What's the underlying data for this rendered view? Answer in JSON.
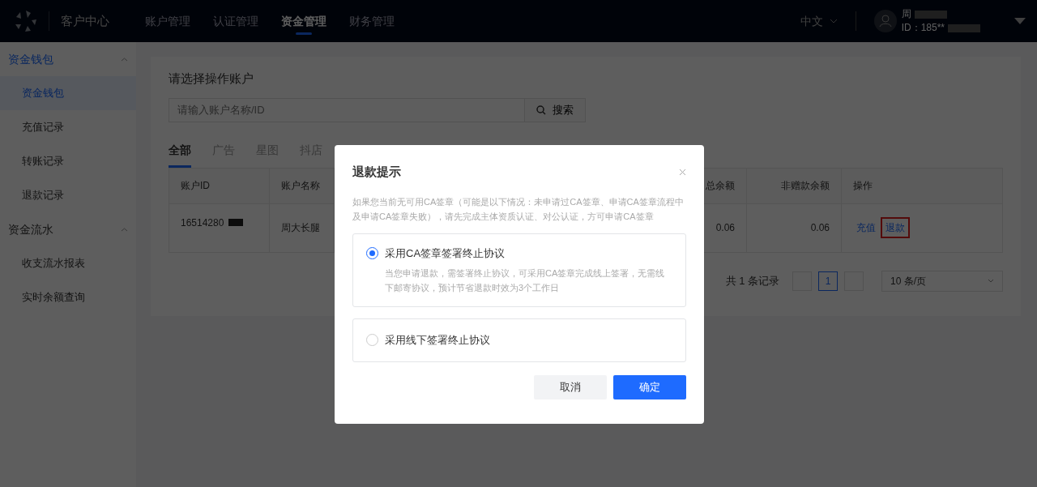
{
  "header": {
    "brand": "客户中心",
    "nav": [
      {
        "label": "账户管理",
        "selected": false
      },
      {
        "label": "认证管理",
        "selected": false
      },
      {
        "label": "资金管理",
        "selected": true
      },
      {
        "label": "财务管理",
        "selected": false
      }
    ],
    "language": "中文",
    "user": {
      "name": "周",
      "id": "ID：185**"
    }
  },
  "sidebar": {
    "groups": [
      {
        "label": "资金钱包",
        "expanded": true,
        "active": true,
        "items": [
          {
            "label": "资金钱包",
            "selected": true
          },
          {
            "label": "充值记录",
            "selected": false
          },
          {
            "label": "转账记录",
            "selected": false
          },
          {
            "label": "退款记录",
            "selected": false
          }
        ]
      },
      {
        "label": "资金流水",
        "expanded": true,
        "active": false,
        "items": [
          {
            "label": "收支流水报表",
            "selected": false
          },
          {
            "label": "实时余额查询",
            "selected": false
          }
        ]
      }
    ]
  },
  "content": {
    "title": "请选择操作账户",
    "search": {
      "placeholder": "请输入账户名称/ID",
      "button": "搜索"
    },
    "tabs": [
      {
        "label": "全部",
        "selected": true
      },
      {
        "label": "广告",
        "selected": false
      },
      {
        "label": "星图",
        "selected": false
      },
      {
        "label": "抖店",
        "selected": false
      }
    ],
    "table": {
      "columns": [
        "账户ID",
        "账户名称",
        "总余额",
        "非赠款余额",
        "操作"
      ],
      "rows": [
        {
          "id": "16514280",
          "name": "周大长腿",
          "total": "0.06",
          "non_gift": "0.06",
          "actions": [
            {
              "label": "充值",
              "highlighted": false
            },
            {
              "label": "退款",
              "highlighted": true
            }
          ]
        }
      ]
    },
    "pagination": {
      "total": "共 1 条记录",
      "pages": [
        {
          "label": "1",
          "selected": true
        }
      ],
      "page_size": "10 条/页"
    }
  },
  "dialog": {
    "title": "退款提示",
    "notice": "如果您当前无可用CA签章（可能是以下情况：未申请过CA签章、申请CA签章流程中及申请CA签章失败），请先完成主体资质认证、对公认证，方可申请CA签章",
    "options": [
      {
        "label": "采用CA签章签署终止协议",
        "description": "当您申请退款，需签署终止协议，可采用CA签章完成线上签署，无需线下邮寄协议，预计节省退款时效为3个工作日",
        "selected": true
      },
      {
        "label": "采用线下签署终止协议",
        "selected": false
      }
    ],
    "buttons": [
      {
        "label": "取消",
        "kind": "secondary"
      },
      {
        "label": "确定",
        "kind": "primary"
      }
    ]
  }
}
